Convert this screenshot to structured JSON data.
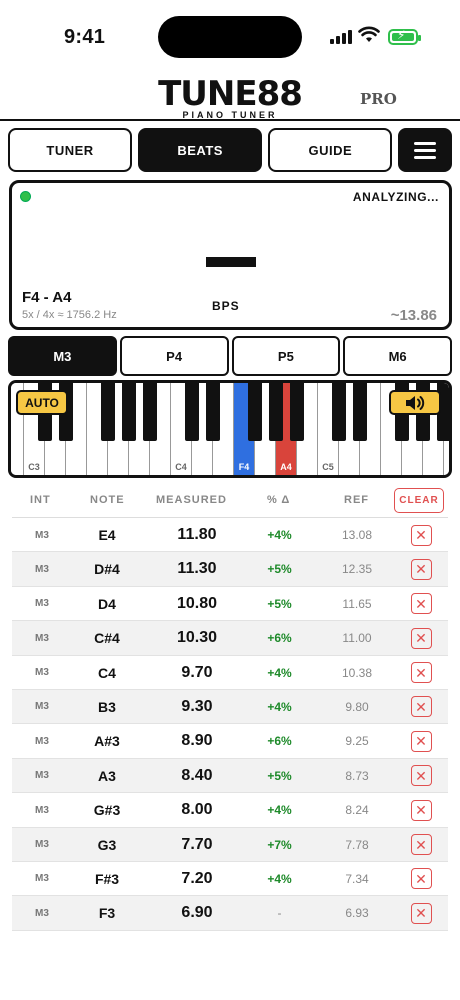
{
  "status_bar": {
    "time": "9:41"
  },
  "header": {
    "app_name": "TUNE88",
    "tagline": "PIANO TUNER",
    "badge": "PRO"
  },
  "tabs": [
    {
      "label": "TUNER",
      "active": false
    },
    {
      "label": "BEATS",
      "active": true
    },
    {
      "label": "GUIDE",
      "active": false
    }
  ],
  "menu_icon": "hamburger-icon",
  "analyzer": {
    "status": "ANALYZING...",
    "indicator_color": "#2fbf4b",
    "reading": "—",
    "pair": "F4 - A4",
    "ratio": "5x / 4x ≈ 1756.2 Hz",
    "unit": "BPS",
    "target": "~13.86"
  },
  "intervals": [
    {
      "label": "M3",
      "active": true
    },
    {
      "label": "P4",
      "active": false
    },
    {
      "label": "P5",
      "active": false
    },
    {
      "label": "M6",
      "active": false
    }
  ],
  "keyboard": {
    "auto_label": "AUTO",
    "speaker_icon": "speaker-icon",
    "labels": {
      "c3": "C3",
      "c4": "C4",
      "f4": "F4",
      "a4": "A4",
      "c5": "C5"
    },
    "colors": {
      "lower_note": "#2f6fe0",
      "upper_note": "#d9443b",
      "button": "#f6c744"
    }
  },
  "table": {
    "headers": {
      "int": "INT",
      "note": "NOTE",
      "measured": "MEASURED",
      "pct": "% Δ",
      "ref": "REF"
    },
    "clear_label": "CLEAR",
    "rows": [
      {
        "int": "M3",
        "note": "E4",
        "measured": "11.80",
        "pct": "+4%",
        "ref": "13.08"
      },
      {
        "int": "M3",
        "note": "D#4",
        "measured": "11.30",
        "pct": "+5%",
        "ref": "12.35"
      },
      {
        "int": "M3",
        "note": "D4",
        "measured": "10.80",
        "pct": "+5%",
        "ref": "11.65"
      },
      {
        "int": "M3",
        "note": "C#4",
        "measured": "10.30",
        "pct": "+6%",
        "ref": "11.00"
      },
      {
        "int": "M3",
        "note": "C4",
        "measured": "9.70",
        "pct": "+4%",
        "ref": "10.38"
      },
      {
        "int": "M3",
        "note": "B3",
        "measured": "9.30",
        "pct": "+4%",
        "ref": "9.80"
      },
      {
        "int": "M3",
        "note": "A#3",
        "measured": "8.90",
        "pct": "+6%",
        "ref": "9.25"
      },
      {
        "int": "M3",
        "note": "A3",
        "measured": "8.40",
        "pct": "+5%",
        "ref": "8.73"
      },
      {
        "int": "M3",
        "note": "G#3",
        "measured": "8.00",
        "pct": "+4%",
        "ref": "8.24"
      },
      {
        "int": "M3",
        "note": "G3",
        "measured": "7.70",
        "pct": "+7%",
        "ref": "7.78"
      },
      {
        "int": "M3",
        "note": "F#3",
        "measured": "7.20",
        "pct": "+4%",
        "ref": "7.34"
      },
      {
        "int": "M3",
        "note": "F3",
        "measured": "6.90",
        "pct": "-",
        "ref": "6.93"
      }
    ],
    "pct_color": "#1e8a2a"
  }
}
